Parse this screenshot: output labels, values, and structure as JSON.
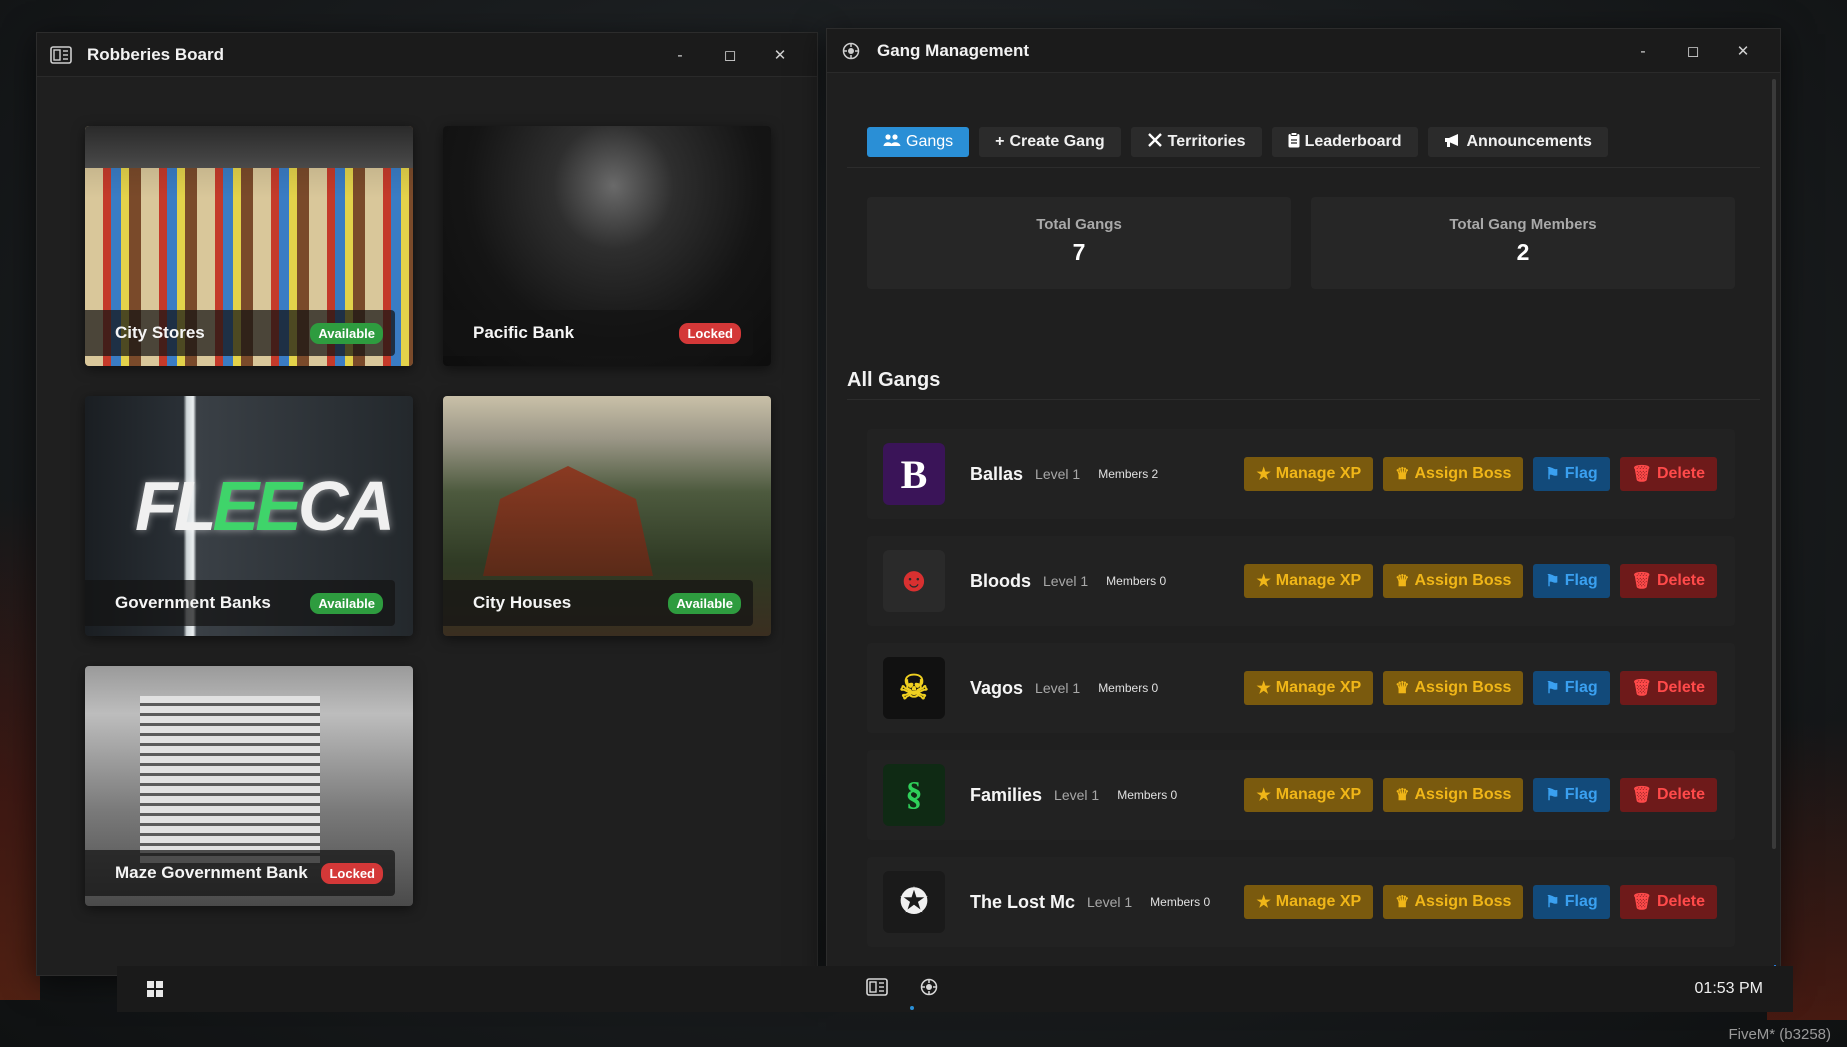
{
  "robberies_window": {
    "title": "Robberies Board",
    "controls": {
      "minimize": "-",
      "maximize": "◻",
      "close": "✕"
    },
    "cards": [
      {
        "name": "City Stores",
        "status": "Available"
      },
      {
        "name": "Pacific Bank",
        "status": "Locked"
      },
      {
        "name": "Government Banks",
        "status": "Available",
        "sign": "FLEECA"
      },
      {
        "name": "City Houses",
        "status": "Available"
      },
      {
        "name": "Maze Government Bank",
        "status": "Locked"
      }
    ]
  },
  "gang_window": {
    "title": "Gang Management",
    "controls": {
      "minimize": "-",
      "maximize": "◻",
      "close": "✕"
    },
    "tabs": [
      {
        "label": "Gangs",
        "icon": "users-icon",
        "active": true
      },
      {
        "label": "Create Gang",
        "icon": "plus-icon"
      },
      {
        "label": "Territories",
        "icon": "swords-icon"
      },
      {
        "label": "Leaderboard",
        "icon": "clipboard-icon"
      },
      {
        "label": "Announcements",
        "icon": "megaphone-icon"
      }
    ],
    "stats": {
      "total_gangs_label": "Total Gangs",
      "total_gangs_value": "7",
      "total_members_label": "Total Gang Members",
      "total_members_value": "2"
    },
    "section_title": "All Gangs",
    "gangs": [
      {
        "name": "Ballas",
        "level": "Level 1",
        "members": "Members 2"
      },
      {
        "name": "Bloods",
        "level": "Level 1",
        "members": "Members 0"
      },
      {
        "name": "Vagos",
        "level": "Level 1",
        "members": "Members 0"
      },
      {
        "name": "Families",
        "level": "Level 1",
        "members": "Members 0"
      },
      {
        "name": "The Lost Mc",
        "level": "Level 1",
        "members": "Members 0"
      }
    ],
    "actions": {
      "manage_xp": "Manage XP",
      "assign_boss": "Assign Boss",
      "flag": "Flag",
      "delete": "Delete"
    }
  },
  "taskbar": {
    "clock": "01:53 PM"
  },
  "watermark": "FiveM* (b3258)",
  "colors": {
    "accent": "#2a8fd6",
    "available": "#2e9c3f",
    "locked": "#d43838",
    "gold": "#f0b618",
    "danger": "#ff4a4a"
  }
}
